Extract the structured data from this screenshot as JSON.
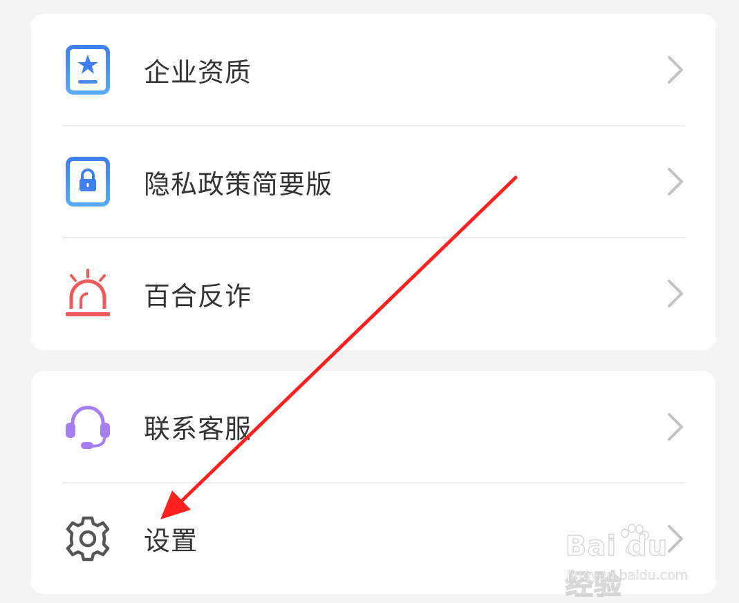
{
  "menu_group_1": {
    "items": [
      {
        "label": "企业资质",
        "icon": "certificate-star-icon",
        "color": "#4a8cf0"
      },
      {
        "label": "隐私政策简要版",
        "icon": "privacy-lock-icon",
        "color": "#4a8cf0"
      },
      {
        "label": "百合反诈",
        "icon": "alarm-siren-icon",
        "color": "#ee5a5a"
      }
    ]
  },
  "menu_group_2": {
    "items": [
      {
        "label": "联系客服",
        "icon": "headset-icon",
        "color": "#a77ef0"
      },
      {
        "label": "设置",
        "icon": "gear-icon",
        "color": "#555555"
      }
    ]
  },
  "chevron_icon": "chevron-right-icon",
  "annotation": {
    "type": "red-arrow-pointing-to-settings",
    "color": "#ff2020"
  },
  "watermark": {
    "logo": "Bai du 经验",
    "url": "jingyan.baidu.com"
  }
}
